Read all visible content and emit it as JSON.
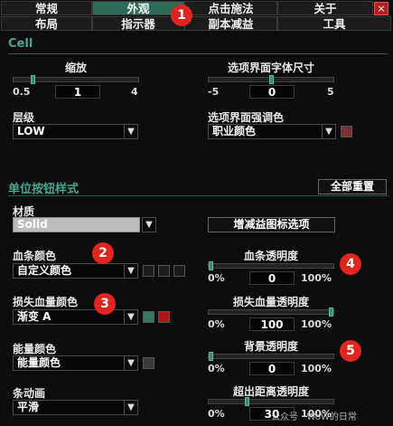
{
  "tabs_row1": [
    {
      "label": "常规",
      "active": false
    },
    {
      "label": "外观",
      "active": true
    },
    {
      "label": "点击施法",
      "active": false
    },
    {
      "label": "关于",
      "active": false
    }
  ],
  "tabs_row2": [
    {
      "label": "布局"
    },
    {
      "label": "指示器"
    },
    {
      "label": "副本减益"
    },
    {
      "label": "工具"
    }
  ],
  "close_label": "×",
  "cell": {
    "title": "Cell",
    "scale": {
      "label": "缩放",
      "min": "0.5",
      "value": "1",
      "max": "4",
      "level": 0.14
    },
    "font_size": {
      "label": "选项界面字体尺寸",
      "min": "-5",
      "value": "0",
      "max": "5",
      "level": 0.5
    },
    "strata": {
      "label": "层级",
      "value": "LOW"
    },
    "accent": {
      "label": "选项界面强调色",
      "value": "职业颜色",
      "swatch": "#7a3030"
    }
  },
  "unit": {
    "title": "单位按钮样式",
    "reset_label": "全部重置",
    "material": {
      "label": "材质",
      "value": "Solid"
    },
    "debuff_icon_btn": "增减益图标选项",
    "health_color": {
      "label": "血条颜色",
      "value": "自定义颜色",
      "swatches": [
        "#1c1c1c",
        "#1c1c1c",
        "#1c1c1c"
      ]
    },
    "health_alpha": {
      "label": "血条透明度",
      "min": "0%",
      "value": "0",
      "max": "100%",
      "level": 0.0
    },
    "loss_color": {
      "label": "损失血量颜色",
      "value": "渐变 A",
      "swatches": [
        "#2f7a62",
        "#b01818"
      ]
    },
    "loss_alpha": {
      "label": "损失血量透明度",
      "min": "0%",
      "value": "100",
      "max": "100%",
      "level": 1.0
    },
    "power_color": {
      "label": "能量颜色",
      "value": "能量颜色",
      "swatches": [
        "#3a3a3a"
      ]
    },
    "bg_alpha": {
      "label": "背景透明度",
      "min": "0%",
      "value": "0",
      "max": "100%",
      "level": 0.0
    },
    "bar_anim": {
      "label": "条动画",
      "value": "平滑"
    },
    "oor_alpha": {
      "label": "超出距离透明度",
      "min": "0%",
      "value": "30",
      "max": "100%",
      "level": 0.3
    }
  },
  "badges": [
    "1",
    "2",
    "3",
    "4",
    "5"
  ],
  "watermark": "公众号 · WoW的日常",
  "colors": {
    "accent": "#45a88e",
    "active_tab": "#2d6a58",
    "badge": "#e0241f"
  }
}
